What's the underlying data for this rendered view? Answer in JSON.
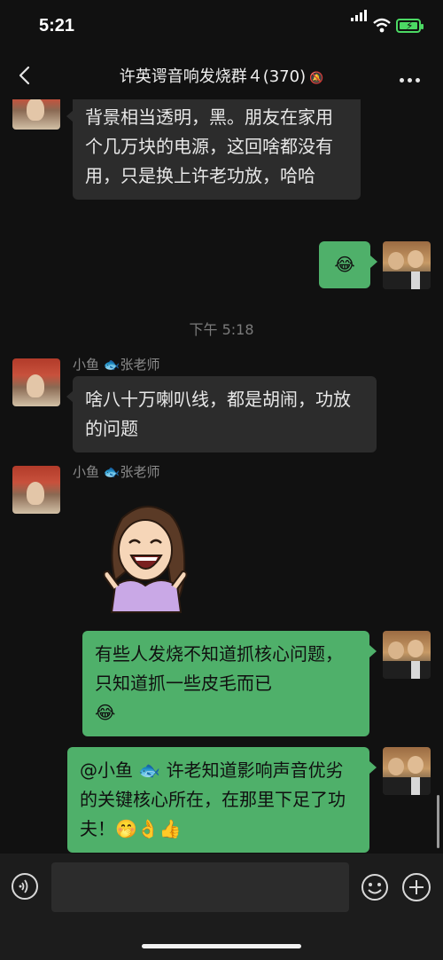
{
  "status": {
    "time": "5:21"
  },
  "nav": {
    "title": "许英谔音响发烧群４(370)",
    "mute_icon": "bell-slash-icon",
    "back_icon": "chevron-left-icon",
    "more_icon": "ellipsis-icon"
  },
  "messages": {
    "m1": {
      "text": "背景相当透明，黑。朋友在家用个几万块的电源，这回啥都没有用，只是换上许老功放，哈哈"
    },
    "m2": {
      "emoji": "😂"
    },
    "timestamp": "下午 5:18",
    "m3": {
      "sender": "小鱼 🐟张老师",
      "text": "啥八十万喇叭线，都是胡闹，功放的问题"
    },
    "m4": {
      "sender": "小鱼 🐟张老师",
      "sticker": "laughing-girl-sticker"
    },
    "m5": {
      "text": "有些人发烧不知道抓核心问题，只知道抓一些皮毛而已",
      "emoji": "😂"
    },
    "m6": {
      "text": "@小鱼 🐟 许老知道影响声音优劣的关键核心所在，在那里下足了功夫！",
      "emoji": "🤭👌👍"
    }
  },
  "input": {
    "voice_icon": "voice-icon",
    "emoji_icon": "smiley-icon",
    "plus_icon": "plus-icon"
  },
  "colors": {
    "bg": "#111111",
    "bubble_left": "#2c2c2c",
    "bubble_right": "#4fb06a",
    "battery": "#4cd964"
  }
}
